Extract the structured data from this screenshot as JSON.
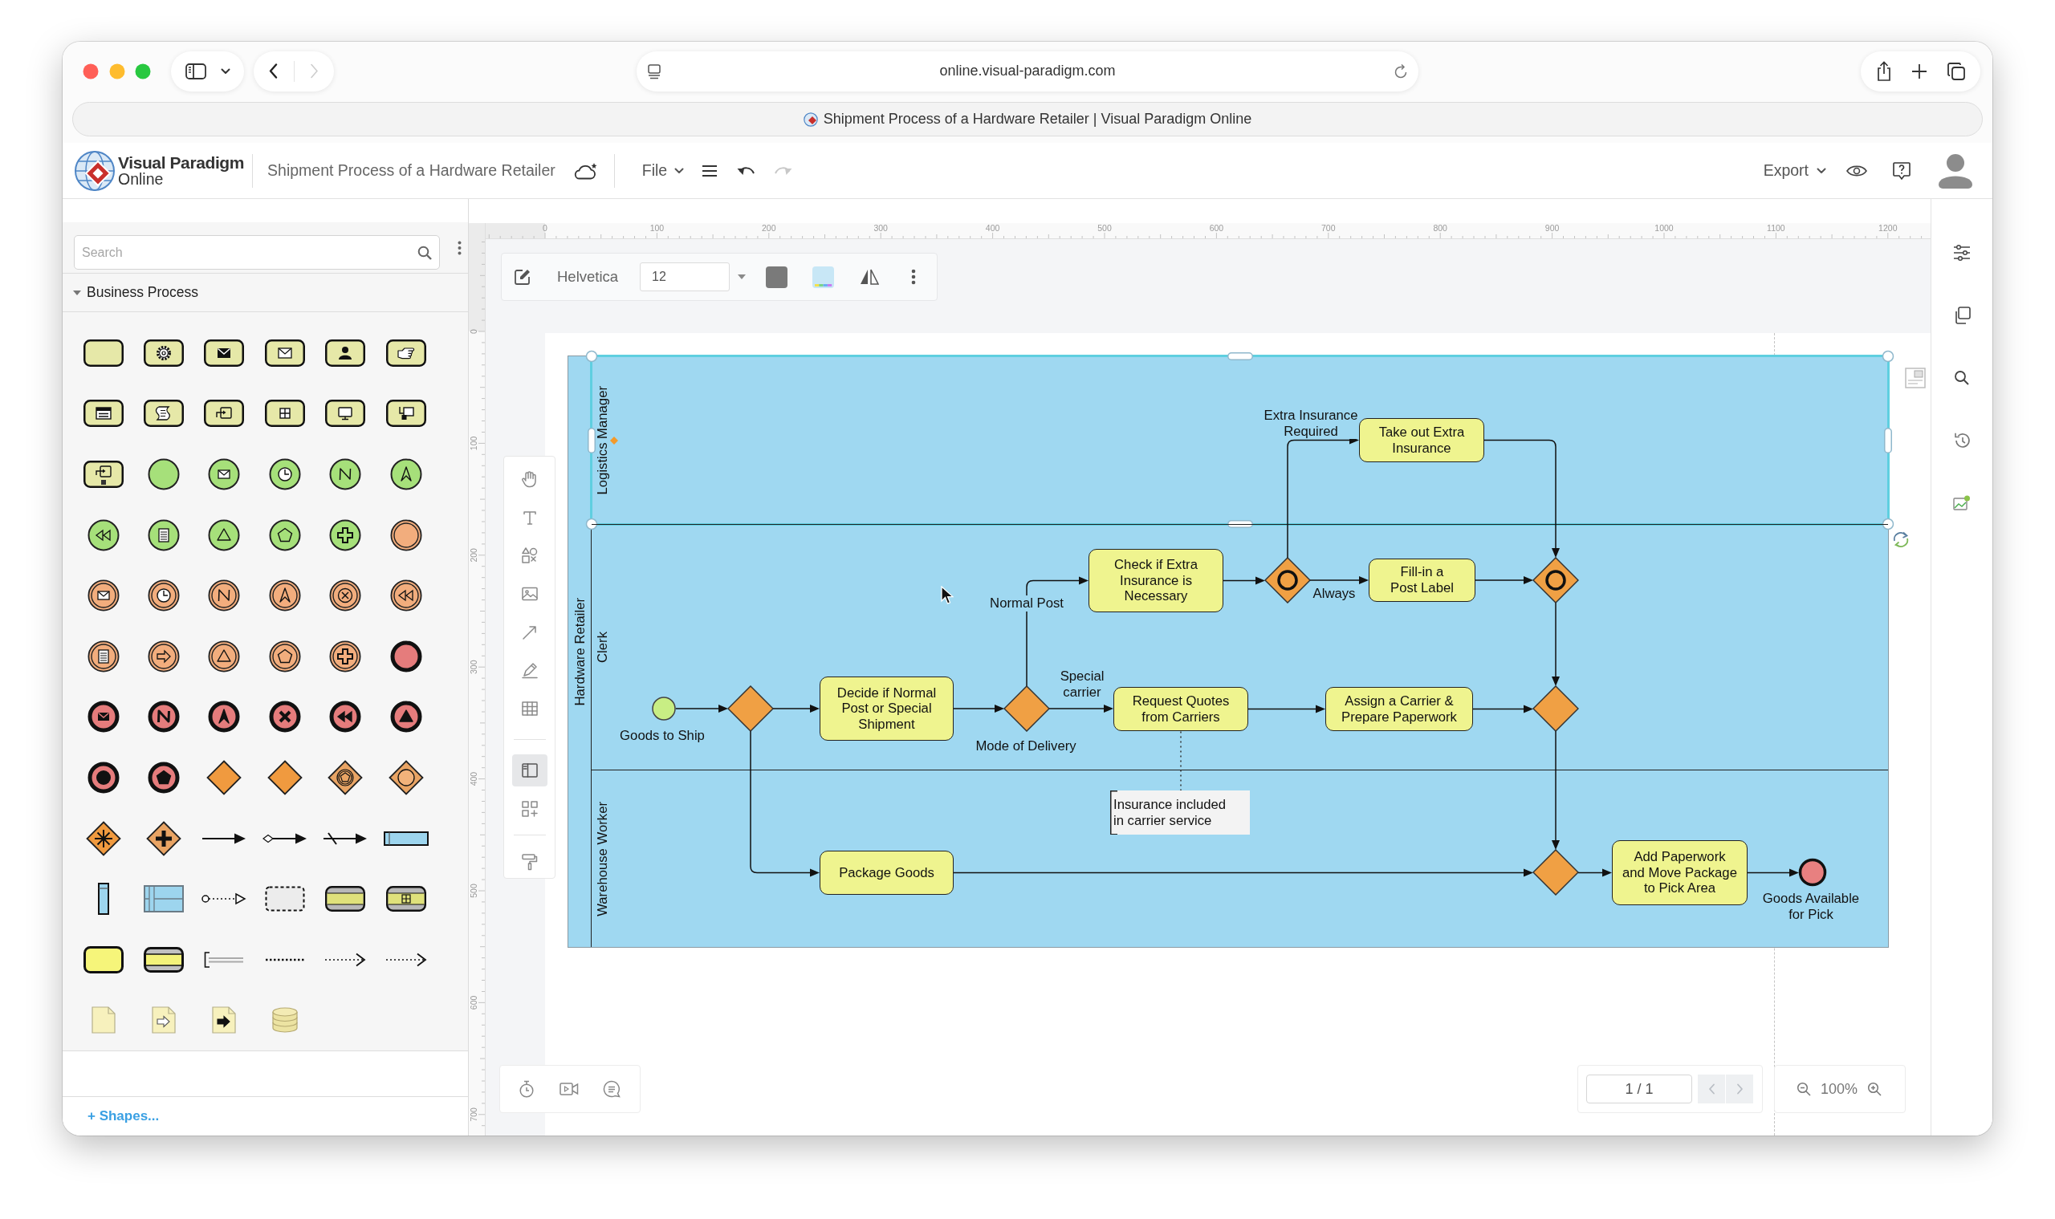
{
  "browser": {
    "nav_buttons": [
      {
        "kind": "back",
        "disabled": false
      },
      {
        "kind": "forward",
        "disabled": true
      }
    ],
    "url": "online.visual-paradigm.com",
    "tab_title": "Shipment Process of a Hardware Retailer | Visual Paradigm Online"
  },
  "app_header": {
    "logo": {
      "name": "Visual Paradigm",
      "product": "Online"
    },
    "document_title": "Shipment Process of a Hardware Retailer",
    "menu": {
      "label": "File"
    },
    "history": [
      {
        "kind": "undo",
        "disabled": false
      },
      {
        "kind": "redo",
        "disabled": true
      }
    ],
    "export": {
      "label": "Export"
    }
  },
  "shape_panel": {
    "search": {
      "placeholder": "Search"
    },
    "category": {
      "label": "Business Process",
      "expanded": true
    },
    "more_shapes": "+ Shapes..."
  },
  "canvas": {
    "format_toolbar": {
      "font": "Helvetica",
      "font_size": "12"
    },
    "rulers": {
      "horizontal": [
        "0",
        "100",
        "200",
        "300",
        "400",
        "500",
        "600",
        "700",
        "800",
        "900",
        "1000",
        "1100",
        "1200"
      ],
      "vertical": [
        "0",
        "100",
        "200",
        "300",
        "400",
        "500",
        "600",
        "700"
      ]
    },
    "tools": [
      {
        "selected": false
      },
      {
        "selected": false
      },
      {
        "selected": false
      },
      {
        "selected": false
      },
      {
        "selected": false
      },
      {
        "selected": false
      },
      {
        "selected": false
      },
      {
        "selected": true
      },
      {
        "selected": false
      },
      {
        "selected": false
      }
    ],
    "diagram": {
      "pool": {
        "label": "Hardware Retailer"
      },
      "lanes": [
        {
          "label": "Logistics Manager",
          "selected": true
        },
        {
          "label": "Clerk",
          "selected": false
        },
        {
          "label": "Warehouse Worker",
          "selected": false
        }
      ],
      "nodes": [
        {
          "kind": "start_event",
          "label": "Goods to Ship"
        },
        {
          "kind": "gateway"
        },
        {
          "kind": "task",
          "label": "Decide if Normal\nPost or Special\nShipment"
        },
        {
          "kind": "gateway",
          "label": "Mode of Delivery"
        },
        {
          "kind": "task",
          "label": "Check if Extra\nInsurance is\nNecessary"
        },
        {
          "kind": "task",
          "label": "Request Quotes\nfrom Carriers"
        },
        {
          "kind": "inclusive_gateway"
        },
        {
          "kind": "task",
          "label": "Take out Extra\nInsurance"
        },
        {
          "kind": "task",
          "label": "Fill-in a\nPost Label"
        },
        {
          "kind": "inclusive_gateway"
        },
        {
          "kind": "task",
          "label": "Assign a Carrier &\nPrepare Paperwork"
        },
        {
          "kind": "gateway"
        },
        {
          "kind": "annotation",
          "label": "Insurance included\nin carrier service"
        },
        {
          "kind": "task",
          "label": "Package Goods"
        },
        {
          "kind": "gateway"
        },
        {
          "kind": "task",
          "label": "Add Paperwork\nand Move Package\nto Pick Area"
        },
        {
          "kind": "end_event",
          "label": "Goods Available\nfor Pick"
        }
      ],
      "flow_labels": [
        "Extra Insurance\nRequired",
        "Normal Post",
        "Always",
        "Special\ncarrier"
      ]
    },
    "page_nav": {
      "page": "1 / 1",
      "buttons": [
        {
          "kind": "previous",
          "disabled": true
        },
        {
          "kind": "next",
          "disabled": true
        }
      ]
    },
    "zoom": {
      "value": "100%"
    }
  }
}
